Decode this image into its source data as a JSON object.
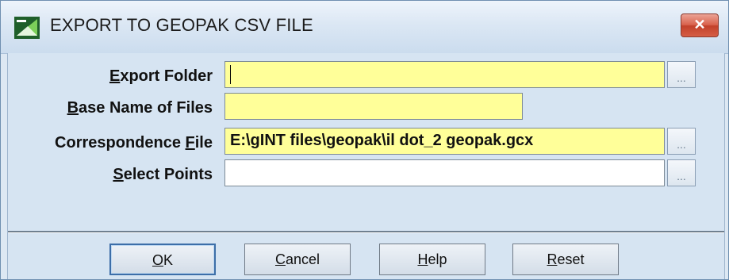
{
  "window": {
    "title": "EXPORT TO GEOPAK CSV FILE",
    "close_label": "✕"
  },
  "form": {
    "export_folder": {
      "label_prefix": "",
      "label_key": "E",
      "label_rest": "xport Folder",
      "value": ""
    },
    "base_name": {
      "label_prefix": "",
      "label_key": "B",
      "label_rest": "ase Name of Files",
      "value": ""
    },
    "correspondence": {
      "label_prefix": "Correspondence ",
      "label_key": "F",
      "label_rest": "ile",
      "value": "E:\\gINT files\\geopak\\il dot_2 geopak.gcx"
    },
    "select_points": {
      "label_prefix": "",
      "label_key": "S",
      "label_rest": "elect Points",
      "value": ""
    },
    "browse_label": "..."
  },
  "buttons": {
    "ok": {
      "key": "O",
      "rest": "K"
    },
    "cancel": {
      "key": "C",
      "rest": "ancel"
    },
    "help": {
      "key": "H",
      "rest": "elp"
    },
    "reset": {
      "key": "R",
      "rest": "eset"
    }
  },
  "colors": {
    "required_field": "#ffff99",
    "optional_field": "#ffffff",
    "client_bg": "#d6e4f2"
  }
}
